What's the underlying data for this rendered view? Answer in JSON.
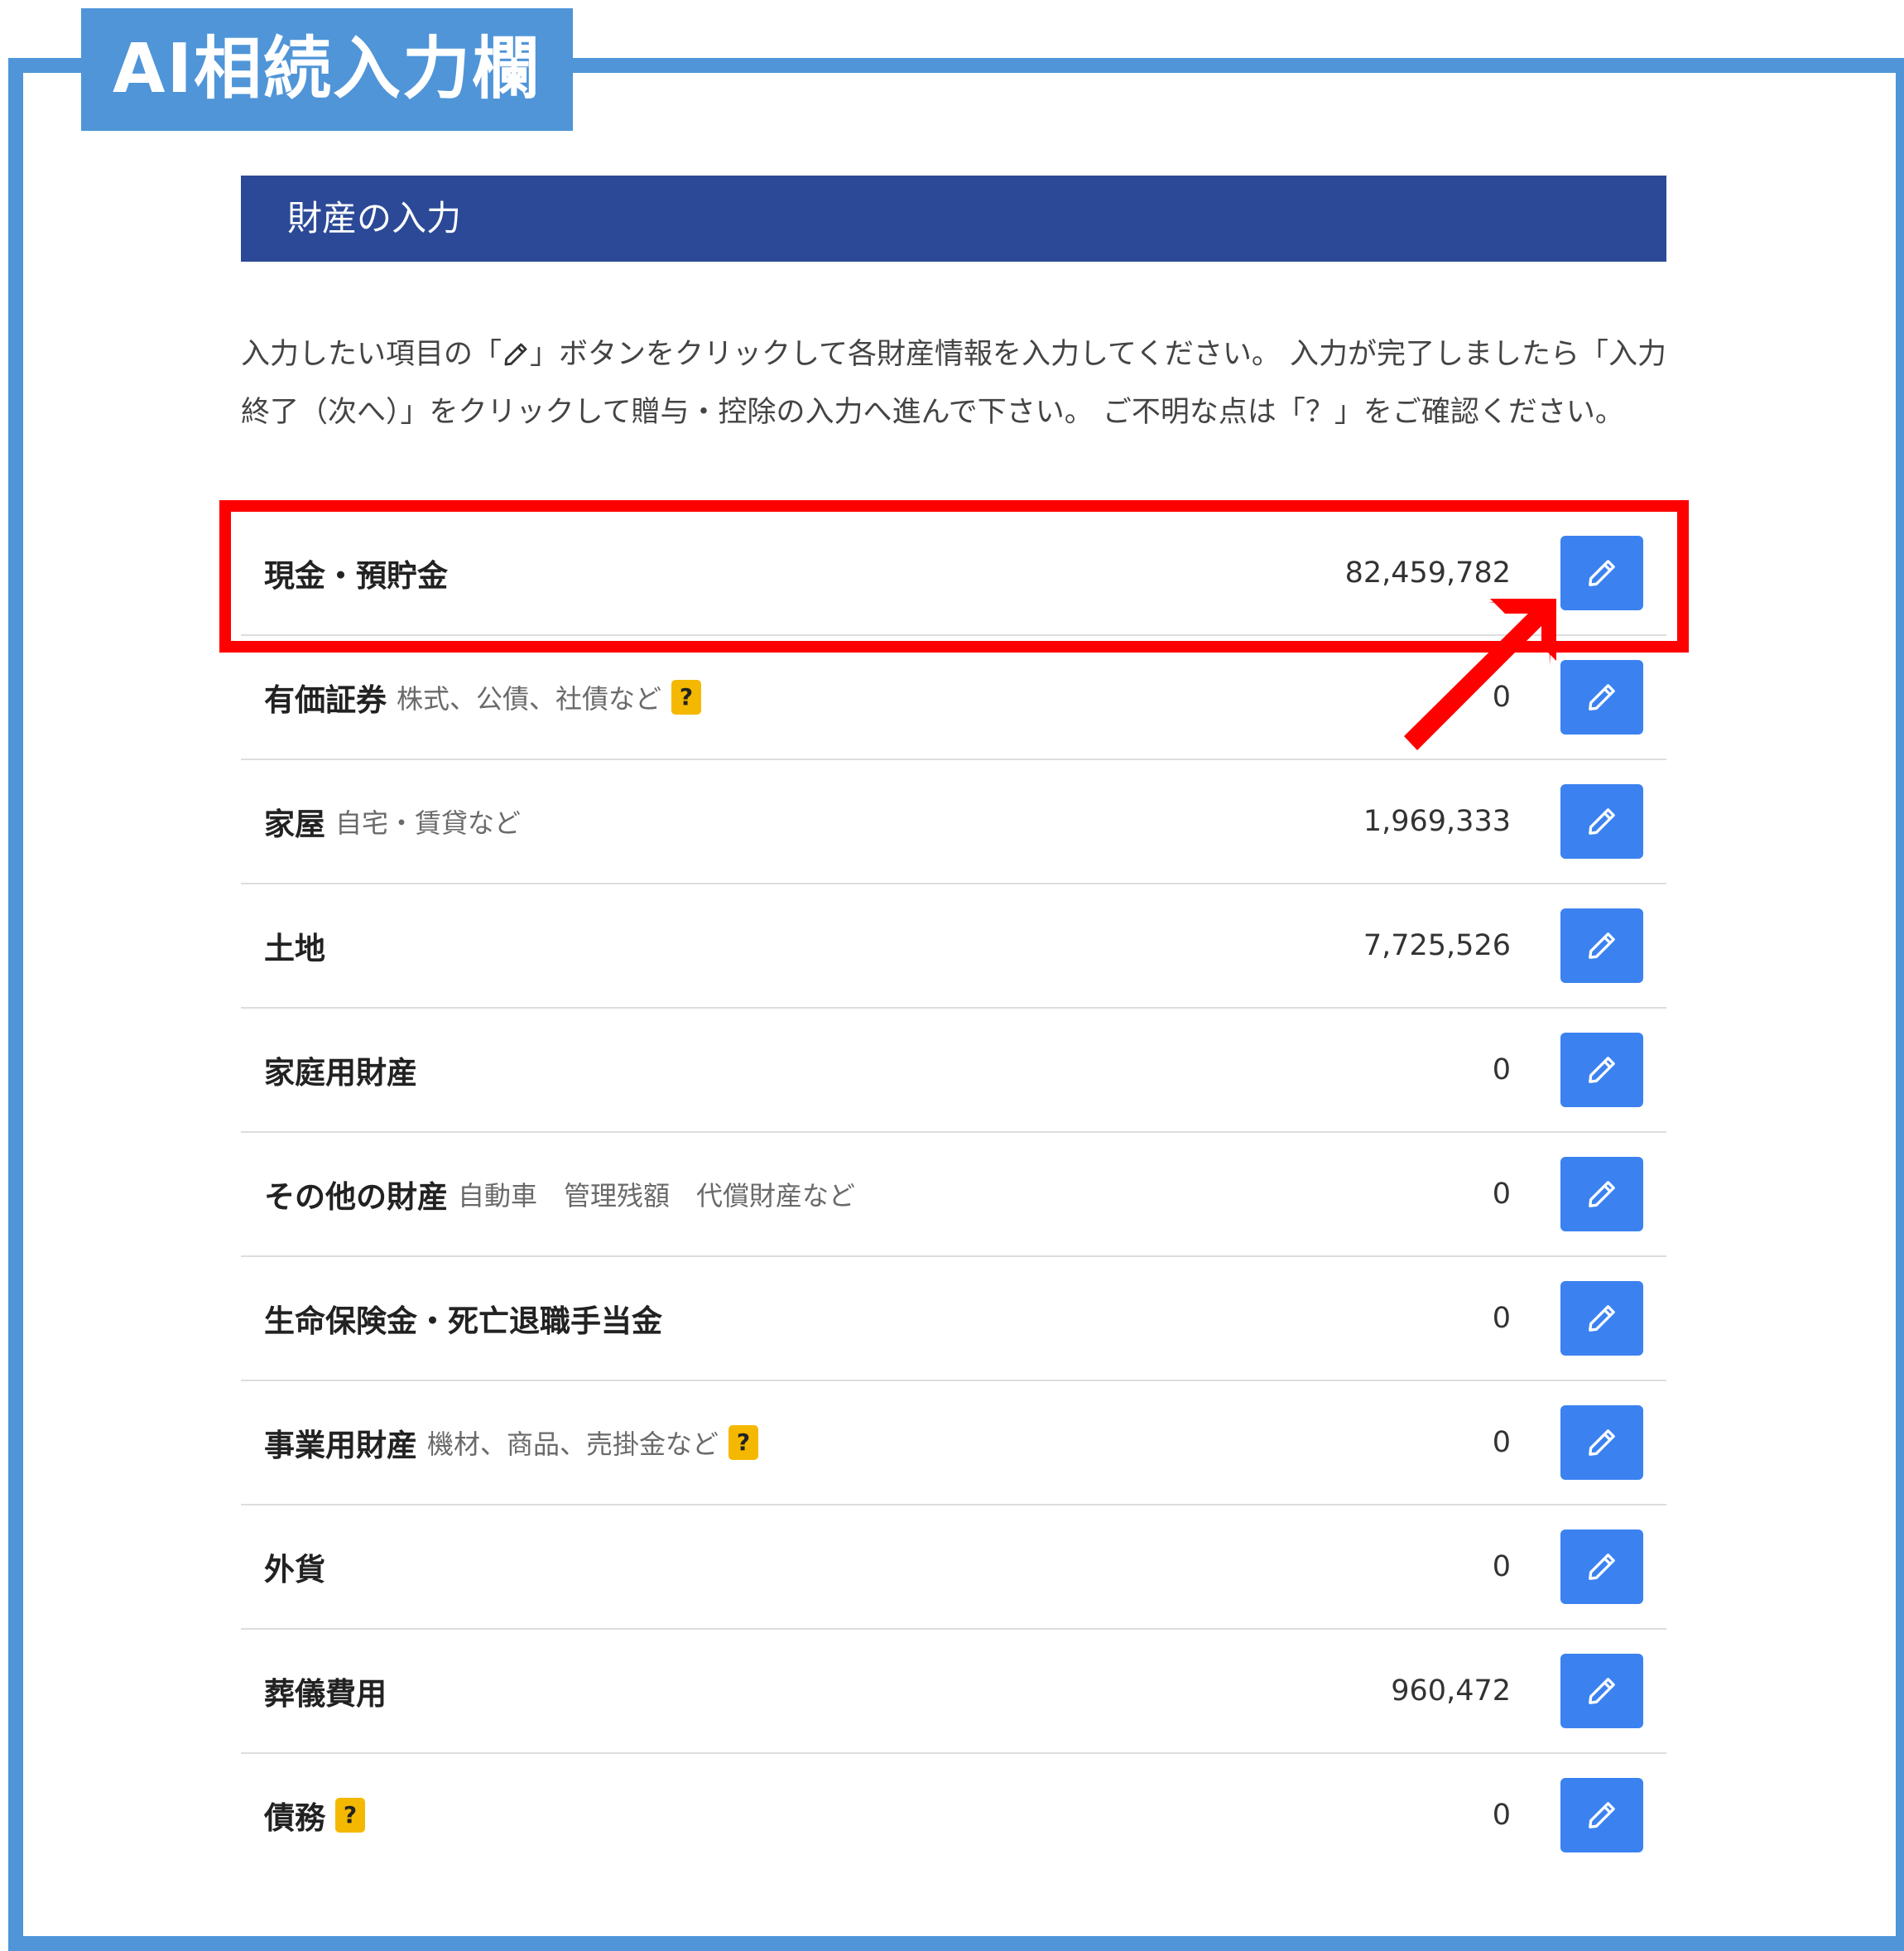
{
  "app_title": "AI相続入力欄",
  "section": {
    "title": "財産の入力",
    "instruction_part1": "入力したい項目の「",
    "instruction_part2": "」ボタンをクリックして各財産情報を入力してください。 入力が完了しましたら「入力終了（次へ）」をクリックして贈与・控除の入力へ進んで下さい。 ご不明な点は「？」をご確認ください。"
  },
  "colors": {
    "frame": "#4f95d8",
    "header": "#2b4996",
    "button": "#3b82f0",
    "highlight": "#ff0000",
    "help_badge": "#f5b800"
  },
  "assets": [
    {
      "label": "現金・預貯金",
      "sub": "",
      "help": false,
      "amount": "82,459,782",
      "icon": "pencil-icon"
    },
    {
      "label": "有価証券",
      "sub": "株式、公債、社債など",
      "help": true,
      "help_text": "?",
      "amount": "0",
      "icon": "pencil-icon"
    },
    {
      "label": "家屋",
      "sub": "自宅・賃貸など",
      "help": false,
      "amount": "1,969,333",
      "icon": "pencil-icon"
    },
    {
      "label": "土地",
      "sub": "",
      "help": false,
      "amount": "7,725,526",
      "icon": "pencil-icon"
    },
    {
      "label": "家庭用財産",
      "sub": "",
      "help": false,
      "amount": "0",
      "icon": "pencil-icon"
    },
    {
      "label": "その他の財産",
      "sub": "自動車　管理残額　代償財産など",
      "help": false,
      "amount": "0",
      "icon": "pencil-icon"
    },
    {
      "label": "生命保険金・死亡退職手当金",
      "sub": "",
      "help": false,
      "amount": "0",
      "icon": "pencil-icon"
    },
    {
      "label": "事業用財産",
      "sub": "機材、商品、売掛金など",
      "help": true,
      "help_text": "?",
      "amount": "0",
      "icon": "pencil-icon"
    },
    {
      "label": "外貨",
      "sub": "",
      "help": false,
      "amount": "0",
      "icon": "pencil-icon"
    },
    {
      "label": "葬儀費用",
      "sub": "",
      "help": false,
      "amount": "960,472",
      "icon": "pencil-icon"
    },
    {
      "label": "債務",
      "sub": "",
      "help": true,
      "help_text": "?",
      "amount": "0",
      "icon": "pencil-icon"
    }
  ]
}
